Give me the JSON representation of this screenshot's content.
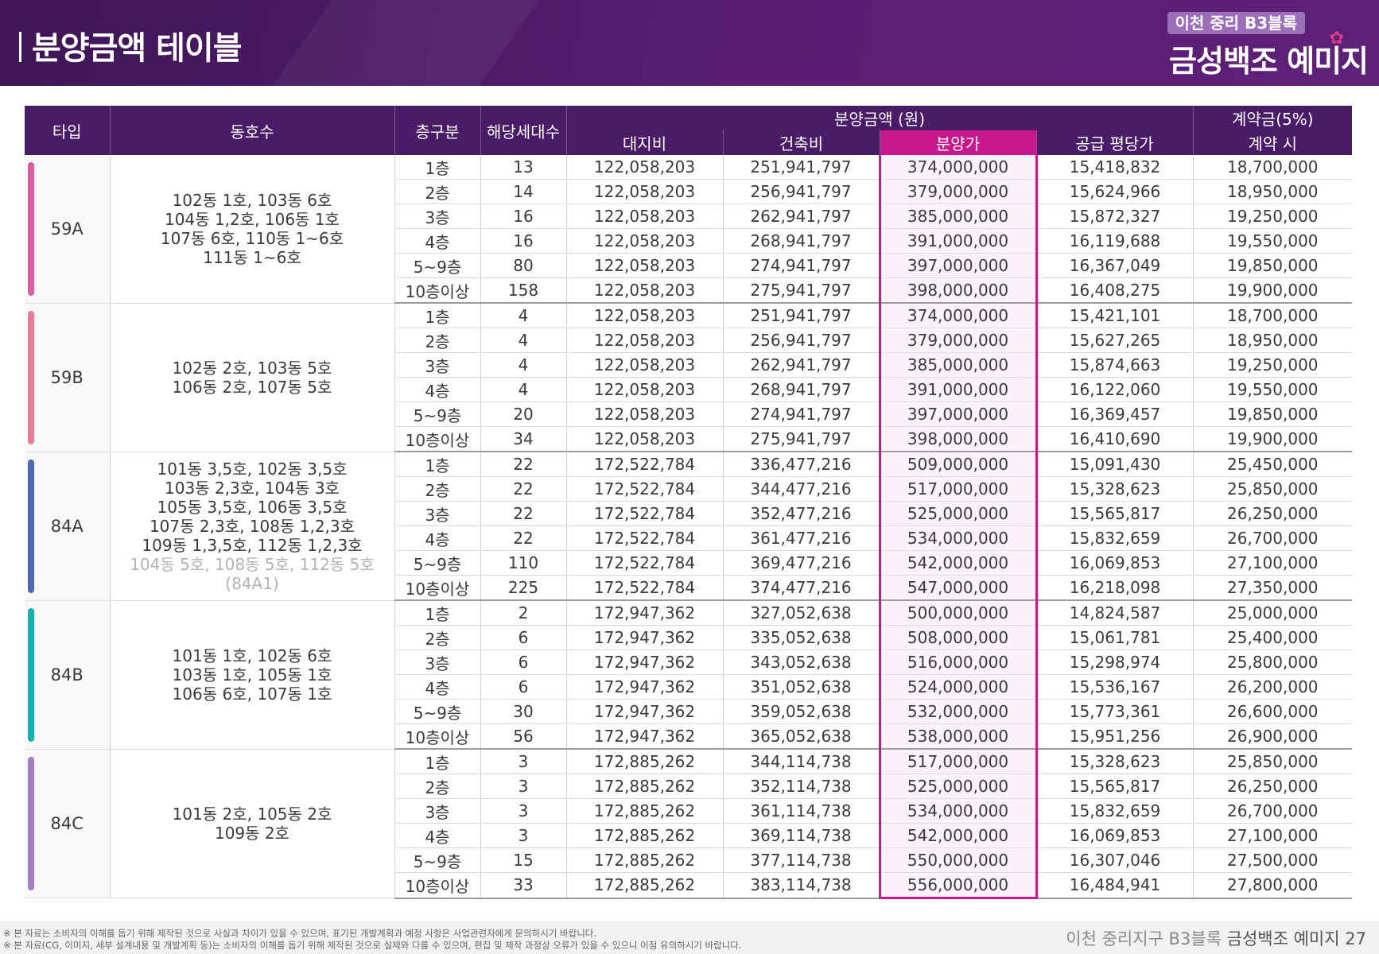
{
  "header": {
    "title": "분양금액 테이블",
    "brand_tag": "이천 중리 B3블록",
    "brand_name": "금성백조 예미지"
  },
  "table": {
    "headers": {
      "type": "타입",
      "units": "동호수",
      "floor": "층구분",
      "households": "해당세대수",
      "price_group": "분양금액 (원)",
      "land": "대지비",
      "building": "건축비",
      "sale": "분양가",
      "per_pyeong": "공급 평당가",
      "deposit_group": "계약금(5%)",
      "deposit_on": "계약 시"
    },
    "groups": [
      {
        "type": "59A",
        "color": "#d95e9e",
        "units": [
          "102동 1호, 103동 6호",
          "104동 1,2호, 106동 1호",
          "107동 6호, 110동 1~6호",
          "111동 1~6호"
        ],
        "units_muted": [],
        "rows": [
          {
            "floor": "1층",
            "households": "13",
            "land": "122,058,203",
            "building": "251,941,797",
            "sale": "374,000,000",
            "per_pyeong": "15,418,832",
            "deposit": "18,700,000"
          },
          {
            "floor": "2층",
            "households": "14",
            "land": "122,058,203",
            "building": "256,941,797",
            "sale": "379,000,000",
            "per_pyeong": "15,624,966",
            "deposit": "18,950,000"
          },
          {
            "floor": "3층",
            "households": "16",
            "land": "122,058,203",
            "building": "262,941,797",
            "sale": "385,000,000",
            "per_pyeong": "15,872,327",
            "deposit": "19,250,000"
          },
          {
            "floor": "4층",
            "households": "16",
            "land": "122,058,203",
            "building": "268,941,797",
            "sale": "391,000,000",
            "per_pyeong": "16,119,688",
            "deposit": "19,550,000"
          },
          {
            "floor": "5~9층",
            "households": "80",
            "land": "122,058,203",
            "building": "274,941,797",
            "sale": "397,000,000",
            "per_pyeong": "16,367,049",
            "deposit": "19,850,000"
          },
          {
            "floor": "10층이상",
            "households": "158",
            "land": "122,058,203",
            "building": "275,941,797",
            "sale": "398,000,000",
            "per_pyeong": "16,408,275",
            "deposit": "19,900,000"
          }
        ]
      },
      {
        "type": "59B",
        "color": "#ea7d93",
        "units": [
          "102동 2호, 103동 5호",
          "106동 2호, 107동 5호"
        ],
        "units_muted": [],
        "rows": [
          {
            "floor": "1층",
            "households": "4",
            "land": "122,058,203",
            "building": "251,941,797",
            "sale": "374,000,000",
            "per_pyeong": "15,421,101",
            "deposit": "18,700,000"
          },
          {
            "floor": "2층",
            "households": "4",
            "land": "122,058,203",
            "building": "256,941,797",
            "sale": "379,000,000",
            "per_pyeong": "15,627,265",
            "deposit": "18,950,000"
          },
          {
            "floor": "3층",
            "households": "4",
            "land": "122,058,203",
            "building": "262,941,797",
            "sale": "385,000,000",
            "per_pyeong": "15,874,663",
            "deposit": "19,250,000"
          },
          {
            "floor": "4층",
            "households": "4",
            "land": "122,058,203",
            "building": "268,941,797",
            "sale": "391,000,000",
            "per_pyeong": "16,122,060",
            "deposit": "19,550,000"
          },
          {
            "floor": "5~9층",
            "households": "20",
            "land": "122,058,203",
            "building": "274,941,797",
            "sale": "397,000,000",
            "per_pyeong": "16,369,457",
            "deposit": "19,850,000"
          },
          {
            "floor": "10층이상",
            "households": "34",
            "land": "122,058,203",
            "building": "275,941,797",
            "sale": "398,000,000",
            "per_pyeong": "16,410,690",
            "deposit": "19,900,000"
          }
        ]
      },
      {
        "type": "84A",
        "color": "#4f68b3",
        "units": [
          "101동 3,5호, 102동 3,5호",
          "103동 2,3호, 104동 3호",
          "105동 3,5호, 106동 3,5호",
          "107동 2,3호, 108동 1,2,3호",
          "109동 1,3,5호, 112동 1,2,3호"
        ],
        "units_muted": [
          "104동 5호, 108동 5호, 112동 5호",
          "(84A1)"
        ],
        "rows": [
          {
            "floor": "1층",
            "households": "22",
            "land": "172,522,784",
            "building": "336,477,216",
            "sale": "509,000,000",
            "per_pyeong": "15,091,430",
            "deposit": "25,450,000"
          },
          {
            "floor": "2층",
            "households": "22",
            "land": "172,522,784",
            "building": "344,477,216",
            "sale": "517,000,000",
            "per_pyeong": "15,328,623",
            "deposit": "25,850,000"
          },
          {
            "floor": "3층",
            "households": "22",
            "land": "172,522,784",
            "building": "352,477,216",
            "sale": "525,000,000",
            "per_pyeong": "15,565,817",
            "deposit": "26,250,000"
          },
          {
            "floor": "4층",
            "households": "22",
            "land": "172,522,784",
            "building": "361,477,216",
            "sale": "534,000,000",
            "per_pyeong": "15,832,659",
            "deposit": "26,700,000"
          },
          {
            "floor": "5~9층",
            "households": "110",
            "land": "172,522,784",
            "building": "369,477,216",
            "sale": "542,000,000",
            "per_pyeong": "16,069,853",
            "deposit": "27,100,000"
          },
          {
            "floor": "10층이상",
            "households": "225",
            "land": "172,522,784",
            "building": "374,477,216",
            "sale": "547,000,000",
            "per_pyeong": "16,218,098",
            "deposit": "27,350,000"
          }
        ]
      },
      {
        "type": "84B",
        "color": "#16b0ad",
        "units": [
          "101동 1호, 102동 6호",
          "103동 1호, 105동 1호",
          "106동 6호, 107동 1호"
        ],
        "units_muted": [],
        "rows": [
          {
            "floor": "1층",
            "households": "2",
            "land": "172,947,362",
            "building": "327,052,638",
            "sale": "500,000,000",
            "per_pyeong": "14,824,587",
            "deposit": "25,000,000"
          },
          {
            "floor": "2층",
            "households": "6",
            "land": "172,947,362",
            "building": "335,052,638",
            "sale": "508,000,000",
            "per_pyeong": "15,061,781",
            "deposit": "25,400,000"
          },
          {
            "floor": "3층",
            "households": "6",
            "land": "172,947,362",
            "building": "343,052,638",
            "sale": "516,000,000",
            "per_pyeong": "15,298,974",
            "deposit": "25,800,000"
          },
          {
            "floor": "4층",
            "households": "6",
            "land": "172,947,362",
            "building": "351,052,638",
            "sale": "524,000,000",
            "per_pyeong": "15,536,167",
            "deposit": "26,200,000"
          },
          {
            "floor": "5~9층",
            "households": "30",
            "land": "172,947,362",
            "building": "359,052,638",
            "sale": "532,000,000",
            "per_pyeong": "15,773,361",
            "deposit": "26,600,000"
          },
          {
            "floor": "10층이상",
            "households": "56",
            "land": "172,947,362",
            "building": "365,052,638",
            "sale": "538,000,000",
            "per_pyeong": "15,951,256",
            "deposit": "26,900,000"
          }
        ]
      },
      {
        "type": "84C",
        "color": "#a77cc0",
        "units": [
          "101동 2호, 105동 2호",
          "109동 2호"
        ],
        "units_muted": [],
        "rows": [
          {
            "floor": "1층",
            "households": "3",
            "land": "172,885,262",
            "building": "344,114,738",
            "sale": "517,000,000",
            "per_pyeong": "15,328,623",
            "deposit": "25,850,000"
          },
          {
            "floor": "2층",
            "households": "3",
            "land": "172,885,262",
            "building": "352,114,738",
            "sale": "525,000,000",
            "per_pyeong": "15,565,817",
            "deposit": "26,250,000"
          },
          {
            "floor": "3층",
            "households": "3",
            "land": "172,885,262",
            "building": "361,114,738",
            "sale": "534,000,000",
            "per_pyeong": "15,832,659",
            "deposit": "26,700,000"
          },
          {
            "floor": "4층",
            "households": "3",
            "land": "172,885,262",
            "building": "369,114,738",
            "sale": "542,000,000",
            "per_pyeong": "16,069,853",
            "deposit": "27,100,000"
          },
          {
            "floor": "5~9층",
            "households": "15",
            "land": "172,885,262",
            "building": "377,114,738",
            "sale": "550,000,000",
            "per_pyeong": "16,307,046",
            "deposit": "27,500,000"
          },
          {
            "floor": "10층이상",
            "households": "33",
            "land": "172,885,262",
            "building": "383,114,738",
            "sale": "556,000,000",
            "per_pyeong": "16,484,941",
            "deposit": "27,800,000"
          }
        ]
      }
    ]
  },
  "footer": {
    "note1": "※ 본 자료는 소비자의 이해를 돕기 위해 제작된 것으로 사실과 차이가 있을 수 있으며, 표기된 개발계획과 예정 사항은 사업관련자에게 문의하시기 바랍니다.",
    "note2": "※ 본 자료(CG, 이미지, 세부 설계내용 및 개발계획 등)는 소비자의 이해를 돕기 위해 제작된 것으로 실제와 다를 수 있으며, 편집 및 제작 과정상 오류가 있을 수 있으니 이점 유의하시기 바랍니다.",
    "site": "이천 중리지구 B3블록",
    "brand": "금성백조 예미지",
    "page": "27"
  },
  "colors": {
    "header_bg": "#4c1a66",
    "table_header_bg": "#4a1c68",
    "highlight": "#c8198c"
  }
}
